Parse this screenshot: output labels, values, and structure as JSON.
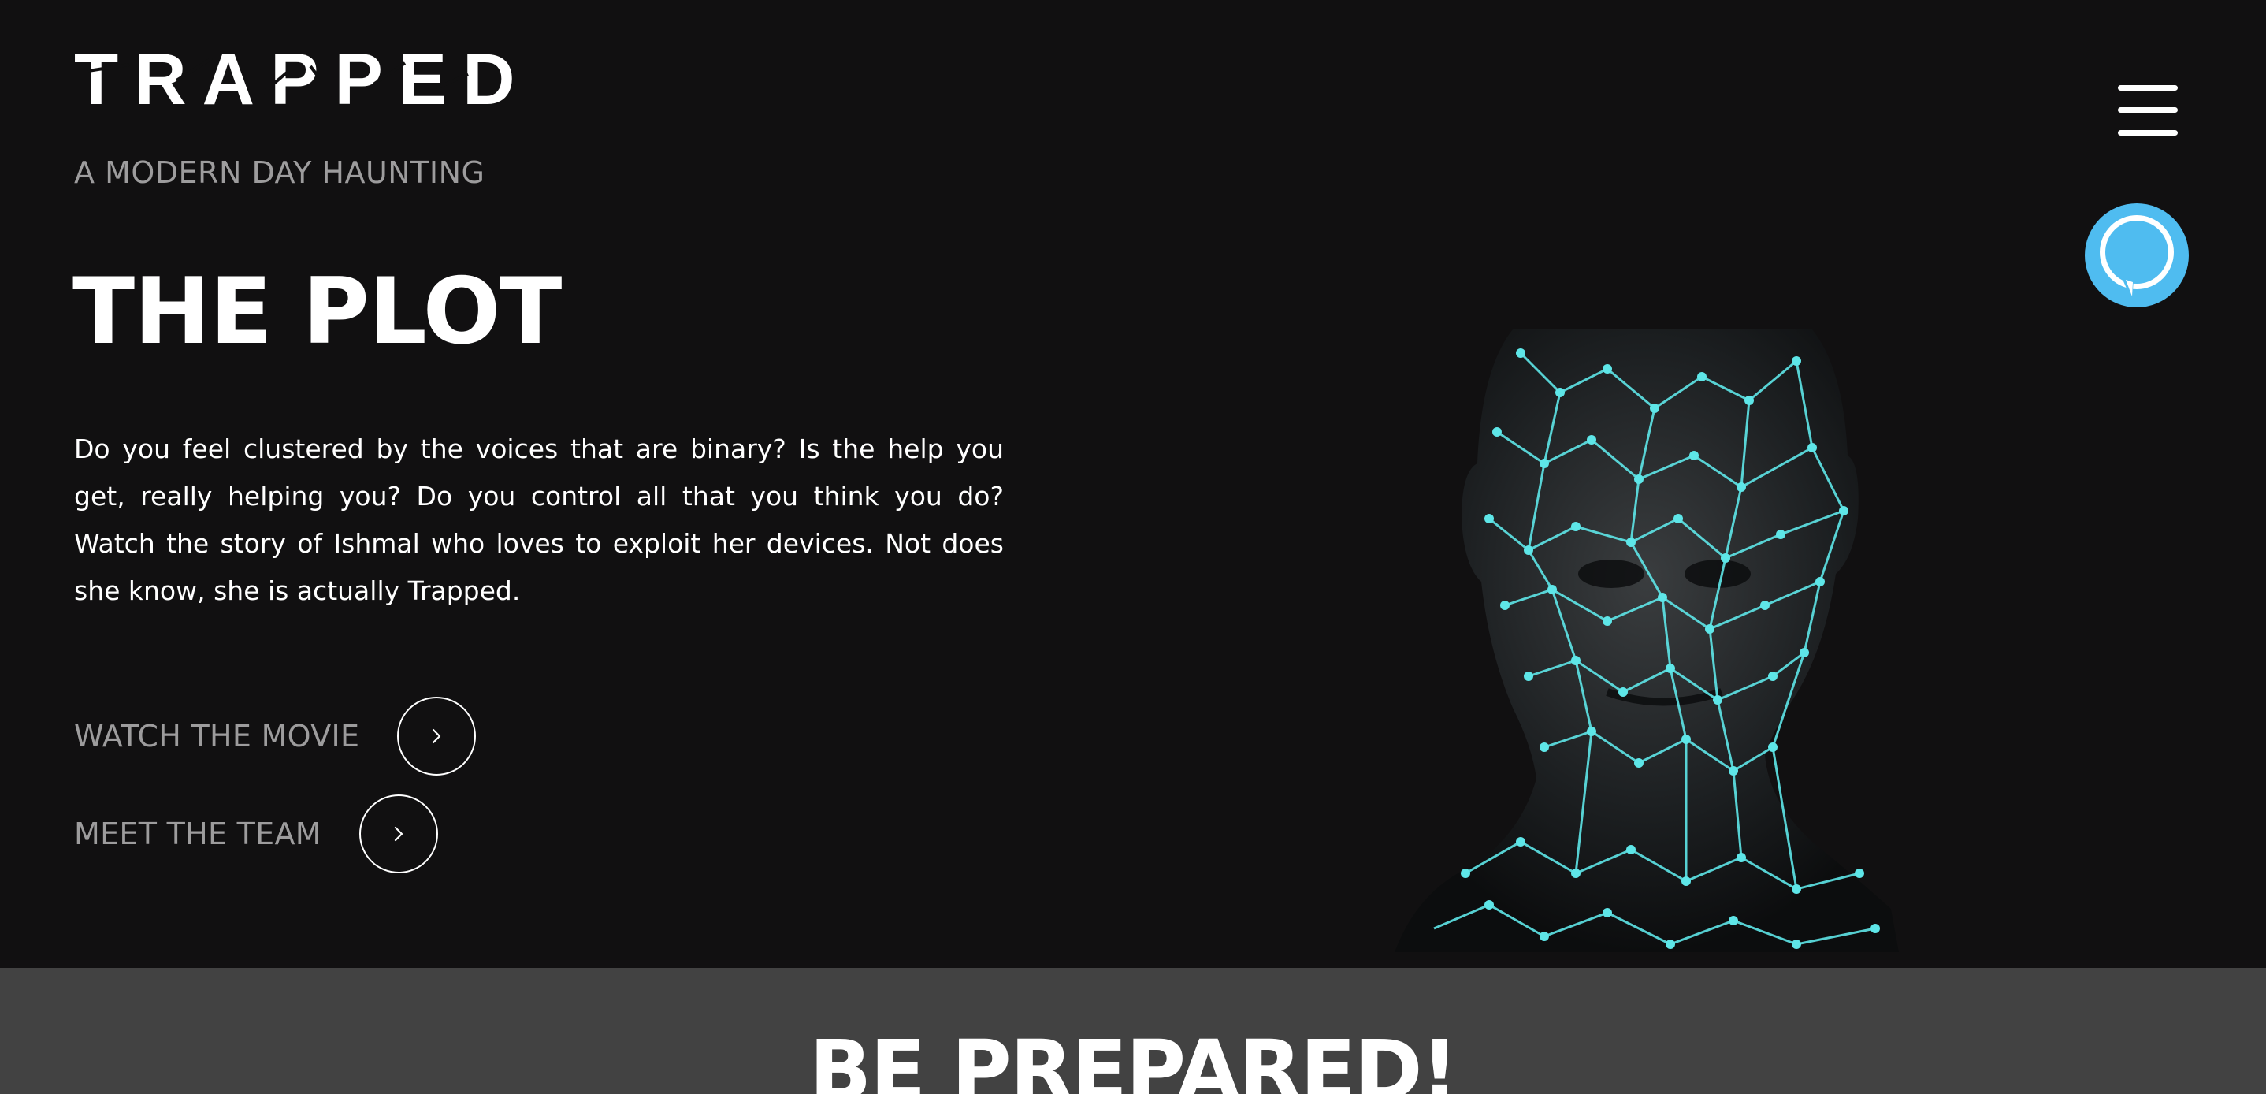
{
  "header": {
    "logo_text": "TRAPPED.",
    "tagline": "A MODERN DAY HAUNTING",
    "menu_icon": "hamburger-menu-icon",
    "assistant_icon": "voice-assistant-icon"
  },
  "plot": {
    "title": "THE PLOT",
    "body": "Do you feel clustered by the voices that are binary? Is the help you get, really helping you? Do you control all that you think you do? Watch the story of Ishmal who loves to exploit her devices. Not does she know, she is actually Trapped."
  },
  "actions": [
    {
      "label": "WATCH THE MOVIE",
      "icon": "chevron-right-icon"
    },
    {
      "label": "MEET THE TEAM",
      "icon": "chevron-right-icon"
    }
  ],
  "next_section": {
    "title": "BE PREPARED!"
  },
  "colors": {
    "background": "#111011",
    "band": "#424242",
    "muted_text": "#9d9c9d",
    "accent_cyan": "#5ee6e8",
    "assistant_blue": "#4fbcf0"
  }
}
